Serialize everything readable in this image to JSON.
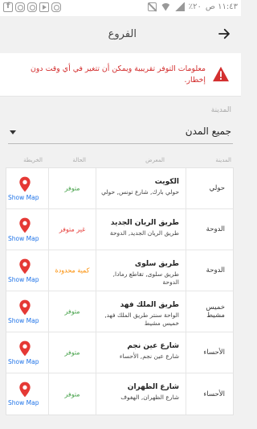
{
  "statusbar": {
    "time": "١١:٤٣ ص",
    "battery": "٪٢٠"
  },
  "appbar": {
    "title": "الفروع"
  },
  "warning": {
    "text": "معلومات التوفر تقريبية ويمكن أن تتغير في أي وقت دون إخطار."
  },
  "filter": {
    "label": "المدينة",
    "value": "جميع المدن"
  },
  "table": {
    "headers": {
      "city": "المدينة",
      "showroom": "المعرض",
      "status": "الحالة",
      "map": "الخريطة"
    },
    "show_map_label": "Show Map",
    "rows": [
      {
        "city": "حولي",
        "title": "الكويت",
        "address": "حولي بارك, شارع تونس, حولي",
        "status": "متوفر"
      },
      {
        "city": "الدوحة",
        "title": "طريق الريان الجديد",
        "address": "طريق الريان الجديد, الدوحة",
        "status": "غير متوفر"
      },
      {
        "city": "الدوحة",
        "title": "طريق سلوى",
        "address": "طريق سلوى, تقاطع رمادا, الدوحة",
        "status": "كمية محدودة"
      },
      {
        "city": "خميس مشيط",
        "title": "طريق الملك فهد",
        "address": "الواحة سنتر طريق الملك فهد, خميس مشيط",
        "status": "متوفر"
      },
      {
        "city": "الأحساء",
        "title": "شارع عين نجم",
        "address": "شارع عين نجم, الأحساء",
        "status": "متوفر"
      },
      {
        "city": "الأحساء",
        "title": "شارع الظهران",
        "address": "شارع الظهران, الهفوف",
        "status": "متوفر"
      }
    ]
  },
  "colors": {
    "available": "#43a047",
    "unavailable": "#e53935",
    "limited": "#fb8c00",
    "warning": "#d32f2f",
    "link": "#1e73e8",
    "pin": "#e53935"
  }
}
